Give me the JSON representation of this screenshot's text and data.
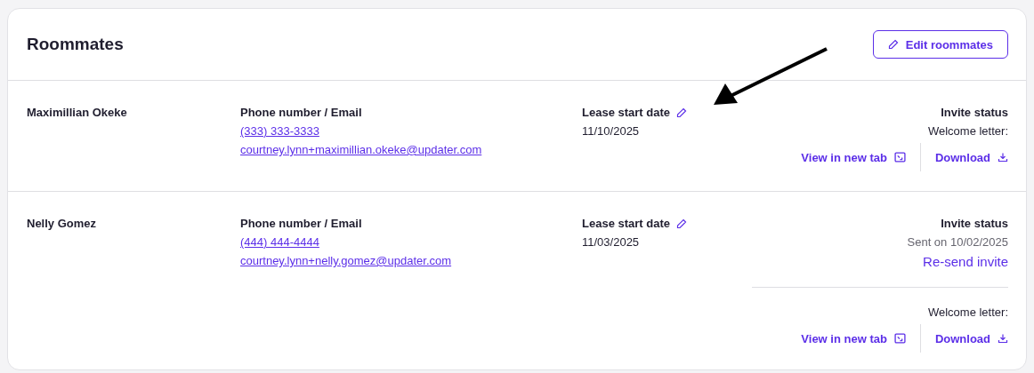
{
  "card": {
    "title": "Roommates",
    "edit_button": "Edit roommates"
  },
  "roommates": [
    {
      "name": "Maximillian Okeke",
      "contact_label": "Phone number / Email",
      "phone": "(333) 333-3333",
      "email": "courtney.lynn+maximillian.okeke@updater.com",
      "lease_label": "Lease start date",
      "lease_date": "11/10/2025",
      "status_label": "Invite status",
      "letter_label": "Welcome letter:",
      "view_link": "View in new tab",
      "download_link": "Download"
    },
    {
      "name": "Nelly Gomez",
      "contact_label": "Phone number / Email",
      "phone": "(444) 444-4444",
      "email": "courtney.lynn+nelly.gomez@updater.com",
      "lease_label": "Lease start date",
      "lease_date": "11/03/2025",
      "status_label": "Invite status",
      "sent_text": "Sent on 10/02/2025",
      "resend_link": "Re-send invite",
      "letter_label": "Welcome letter:",
      "view_link": "View in new tab",
      "download_link": "Download"
    }
  ],
  "annotation": {
    "kind": "arrow"
  }
}
